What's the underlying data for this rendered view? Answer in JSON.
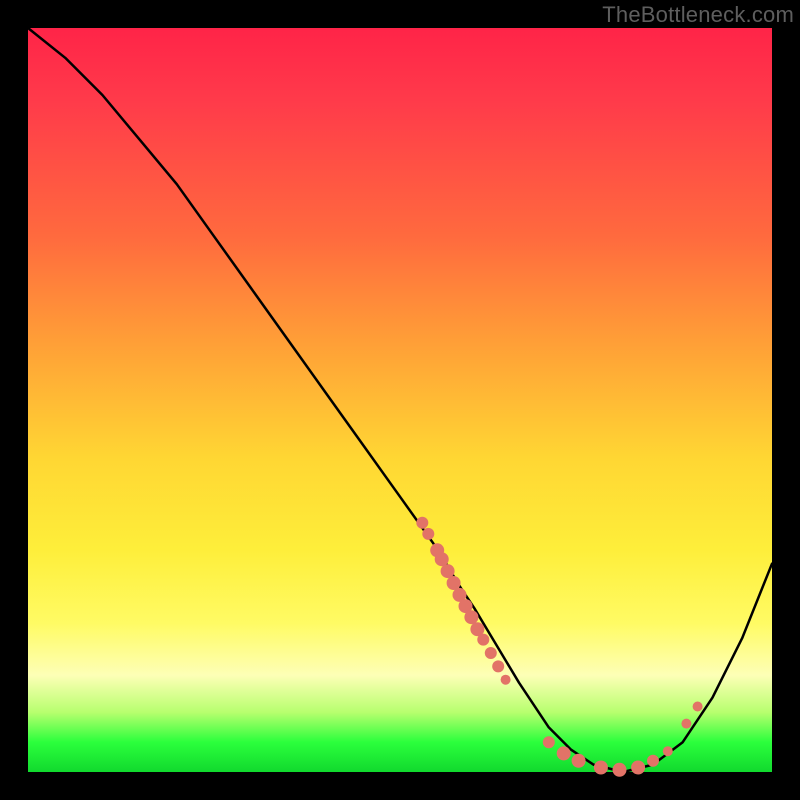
{
  "watermark": "TheBottleneck.com",
  "chart_data": {
    "type": "line",
    "title": "",
    "xlabel": "",
    "ylabel": "",
    "xlim": [
      0,
      100
    ],
    "ylim": [
      0,
      100
    ],
    "grid": false,
    "legend": false,
    "series": [
      {
        "name": "bottleneck-curve",
        "x": [
          0,
          5,
          10,
          15,
          20,
          25,
          30,
          35,
          40,
          45,
          50,
          55,
          58,
          60,
          63,
          66,
          70,
          73,
          76,
          80,
          84,
          88,
          92,
          96,
          100
        ],
        "y": [
          100,
          96,
          91,
          85,
          79,
          72,
          65,
          58,
          51,
          44,
          37,
          30,
          25,
          22,
          17,
          12,
          6,
          3,
          1,
          0,
          1,
          4,
          10,
          18,
          28
        ]
      }
    ],
    "scatter_clusters": [
      {
        "name": "cluster-mid-slope",
        "approx_x_range": [
          53,
          63
        ],
        "approx_y_range": [
          15,
          35
        ],
        "count": 14
      },
      {
        "name": "cluster-near-min",
        "approx_x_range": [
          70,
          86
        ],
        "approx_y_range": [
          0,
          4
        ],
        "count": 8
      },
      {
        "name": "cluster-right-rise",
        "approx_x_range": [
          88,
          90
        ],
        "approx_y_range": [
          6,
          9
        ],
        "count": 2
      }
    ],
    "scatter_points": [
      {
        "x": 53.0,
        "y": 33.5,
        "r": 6
      },
      {
        "x": 53.8,
        "y": 32.0,
        "r": 6
      },
      {
        "x": 55.0,
        "y": 29.8,
        "r": 7
      },
      {
        "x": 55.6,
        "y": 28.6,
        "r": 7
      },
      {
        "x": 56.4,
        "y": 27.0,
        "r": 7
      },
      {
        "x": 57.2,
        "y": 25.4,
        "r": 7
      },
      {
        "x": 58.0,
        "y": 23.8,
        "r": 7
      },
      {
        "x": 58.8,
        "y": 22.3,
        "r": 7
      },
      {
        "x": 59.6,
        "y": 20.8,
        "r": 7
      },
      {
        "x": 60.4,
        "y": 19.2,
        "r": 7
      },
      {
        "x": 61.2,
        "y": 17.8,
        "r": 6
      },
      {
        "x": 62.2,
        "y": 16.0,
        "r": 6
      },
      {
        "x": 63.2,
        "y": 14.2,
        "r": 6
      },
      {
        "x": 64.2,
        "y": 12.4,
        "r": 5
      },
      {
        "x": 70.0,
        "y": 4.0,
        "r": 6
      },
      {
        "x": 72.0,
        "y": 2.5,
        "r": 7
      },
      {
        "x": 74.0,
        "y": 1.5,
        "r": 7
      },
      {
        "x": 77.0,
        "y": 0.6,
        "r": 7
      },
      {
        "x": 79.5,
        "y": 0.3,
        "r": 7
      },
      {
        "x": 82.0,
        "y": 0.6,
        "r": 7
      },
      {
        "x": 84.0,
        "y": 1.5,
        "r": 6
      },
      {
        "x": 86.0,
        "y": 2.8,
        "r": 5
      },
      {
        "x": 88.5,
        "y": 6.5,
        "r": 5
      },
      {
        "x": 90.0,
        "y": 8.8,
        "r": 5
      }
    ],
    "colors": {
      "curve": "#000000",
      "points": "#e27367"
    }
  }
}
